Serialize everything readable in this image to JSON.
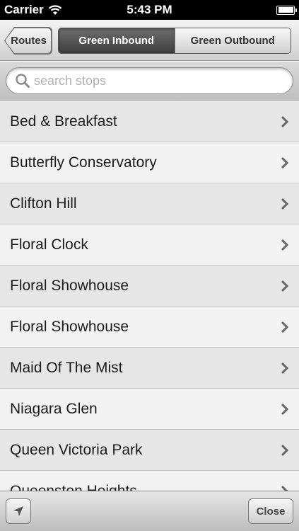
{
  "status_bar": {
    "carrier": "Carrier",
    "time": "5:43 PM"
  },
  "nav": {
    "back_label": "Routes",
    "segments": [
      {
        "label": "Green Inbound",
        "selected": true
      },
      {
        "label": "Green Outbound",
        "selected": false
      }
    ]
  },
  "search": {
    "placeholder": "search stops",
    "value": ""
  },
  "stops": [
    {
      "name": "Bed & Breakfast"
    },
    {
      "name": "Butterfly Conservatory"
    },
    {
      "name": "Clifton Hill"
    },
    {
      "name": "Floral Clock"
    },
    {
      "name": "Floral Showhouse"
    },
    {
      "name": "Floral Showhouse"
    },
    {
      "name": "Maid Of The Mist"
    },
    {
      "name": "Niagara Glen"
    },
    {
      "name": "Queen Victoria Park"
    },
    {
      "name": "Queenston Heights"
    }
  ],
  "toolbar": {
    "close_label": "Close"
  },
  "icons": {
    "wifi": "wifi-icon",
    "battery": "battery-icon",
    "search": "search-icon",
    "chevron": "chevron-right-icon",
    "locate": "location-arrow-icon"
  },
  "colors": {
    "selected_segment": "#4f4f4f",
    "row_odd": "#e6e6e6",
    "row_even": "#f2f2f2"
  }
}
